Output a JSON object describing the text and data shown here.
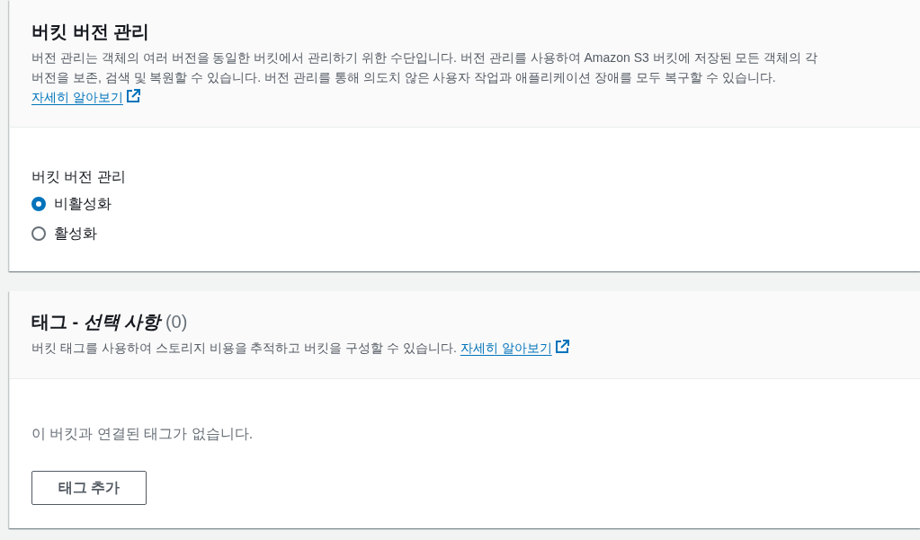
{
  "versioning_panel": {
    "title": "버킷 버전 관리",
    "description": "버전 관리는 객체의 여러 버전을 동일한 버킷에서 관리하기 위한 수단입니다. 버전 관리를 사용하여 Amazon S3 버킷에 저장된 모든 객체의 각 버전을 보존, 검색 및 복원할 수 있습니다. 버전 관리를 통해 의도치 않은 사용자 작업과 애플리케이션 장애를 모두 복구할 수 있습니다.",
    "link": "자세히 알아보기",
    "field_label": "버킷 버전 관리",
    "options": [
      {
        "label": "비활성화",
        "selected": true
      },
      {
        "label": "활성화",
        "selected": false
      }
    ]
  },
  "tags_panel": {
    "title": "태그 - *선택 사항*",
    "count": "(0)",
    "description": "버킷 태그를 사용하여 스토리지 비용을 추적하고 버킷을 구성할 수 있습니다.",
    "link": "자세히 알아보기",
    "empty_message": "이 버킷과 연결된 태그가 없습니다.",
    "button": "태그 추가"
  }
}
